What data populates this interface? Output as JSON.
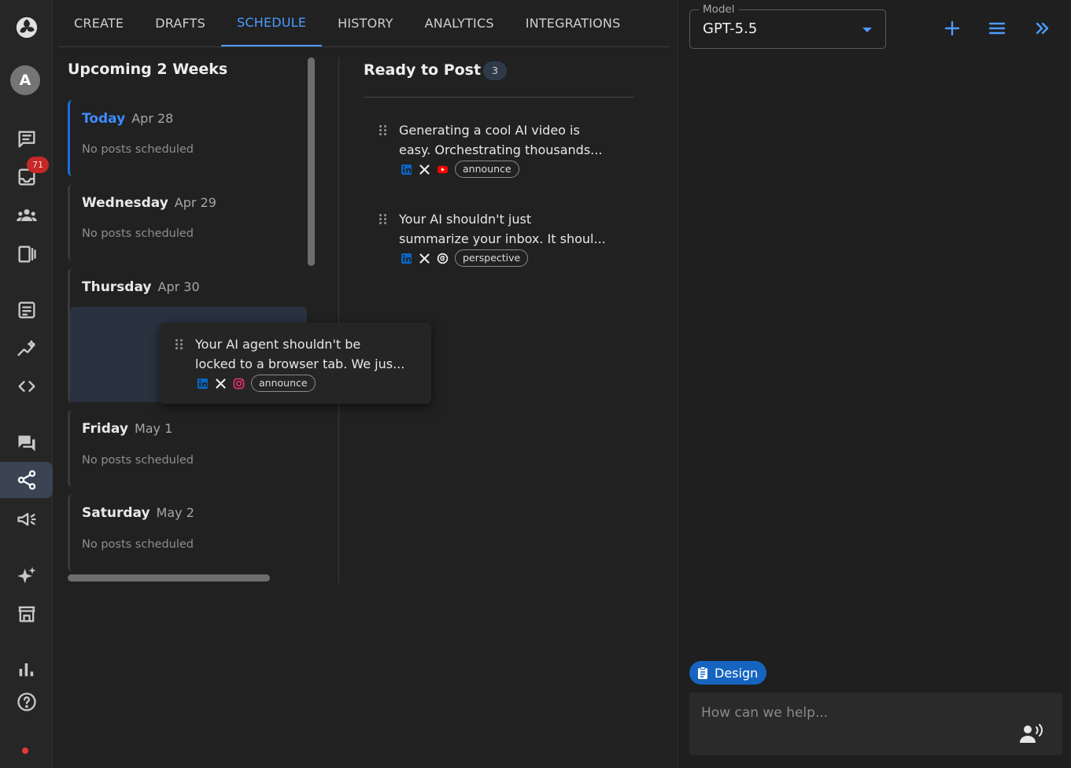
{
  "nav": {
    "tabs": [
      {
        "label": "CREATE"
      },
      {
        "label": "DRAFTS"
      },
      {
        "label": "SCHEDULE",
        "active": true
      },
      {
        "label": "HISTORY"
      },
      {
        "label": "ANALYTICS"
      },
      {
        "label": "INTEGRATIONS"
      }
    ]
  },
  "rail": {
    "avatar_initial": "A",
    "inbox_badge": "71",
    "icons": [
      "app-logo-icon",
      "avatar",
      "messages-icon",
      "inbox-icon",
      "people-icon",
      "library-icon",
      "notes-icon",
      "analytics-trend-icon",
      "code-icon",
      "forum-icon",
      "share-icon",
      "megaphone-icon",
      "sparkle-icon",
      "store-icon",
      "bar-chart-icon",
      "help-icon",
      "status-dot-icon"
    ],
    "active": "share-icon"
  },
  "upcoming": {
    "title": "Upcoming 2 Weeks",
    "days": [
      {
        "name": "Today",
        "date": "Apr 28",
        "empty": "No posts scheduled"
      },
      {
        "name": "Wednesday",
        "date": "Apr 29",
        "empty": "No posts scheduled"
      },
      {
        "name": "Thursday",
        "date": "Apr 30",
        "empty": ""
      },
      {
        "name": "Friday",
        "date": "May 1",
        "empty": "No posts scheduled"
      },
      {
        "name": "Saturday",
        "date": "May 2",
        "empty": "No posts scheduled"
      }
    ]
  },
  "ready": {
    "title": "Ready to Post",
    "count": "3",
    "posts": [
      {
        "line1": "Generating a cool AI video is",
        "line2": "easy. Orchestrating thousands...",
        "platforms": [
          "linkedin-icon",
          "x-icon",
          "youtube-icon"
        ],
        "tag": "announce"
      },
      {
        "line1": "Your AI shouldn't just",
        "line2": "summarize your inbox. It shoul...",
        "platforms": [
          "linkedin-icon",
          "x-icon",
          "threads-icon"
        ],
        "tag": "perspective"
      }
    ]
  },
  "dragging": {
    "line1": "Your AI agent shouldn't be",
    "line2": "locked to a browser tab. We jus...",
    "platforms": [
      "linkedin-icon",
      "x-icon",
      "instagram-icon"
    ],
    "tag": "announce"
  },
  "chat": {
    "model_label": "Model",
    "model_value": "GPT-5.5",
    "design_chip": "Design",
    "input_placeholder": "How can we help..."
  },
  "colors": {
    "accent": "#4c9cff",
    "linkedin": "#0a66c2",
    "youtube": "#ff0000",
    "instagram": "#e1306c",
    "badge": "#c62828"
  }
}
